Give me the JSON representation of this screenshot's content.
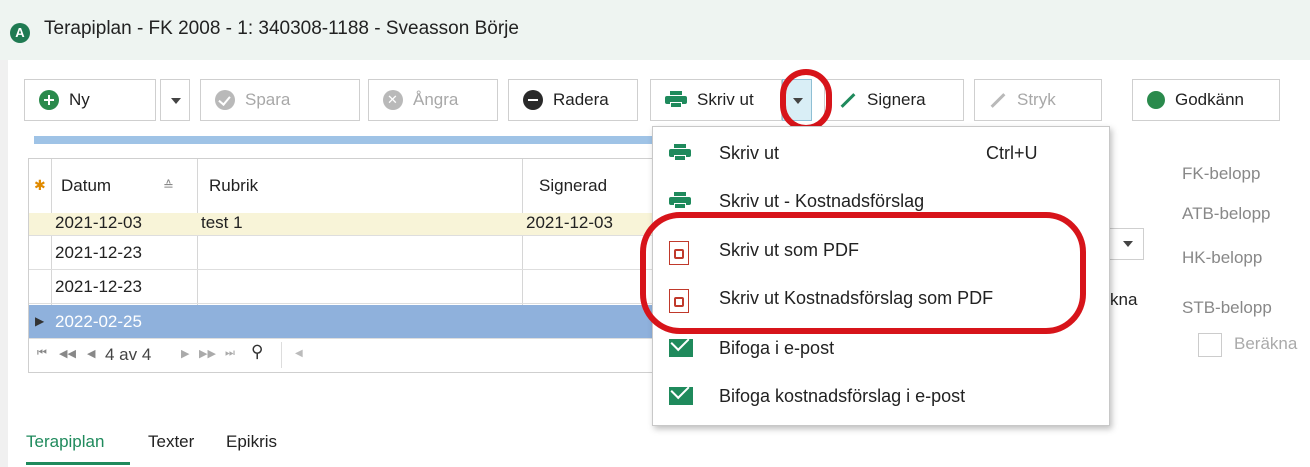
{
  "window": {
    "app_icon_letter": "A",
    "title": "Terapiplan - FK 2008 - 1: 340308-1188 - Sveasson Börje"
  },
  "toolbar": {
    "new_label": "Ny",
    "save_label": "Spara",
    "undo_label": "Ångra",
    "delete_label": "Radera",
    "print_label": "Skriv ut",
    "sign_label": "Signera",
    "strike_label": "Stryk",
    "approve_label": "Godkänn"
  },
  "grid": {
    "columns": [
      "Datum",
      "Rubrik",
      "Signerad"
    ],
    "rows": [
      {
        "datum": "2021-12-03",
        "rubrik": "test 1",
        "signerad": "2021-12-03"
      },
      {
        "datum": "2021-12-23",
        "rubrik": "",
        "signerad": ""
      },
      {
        "datum": "2021-12-23",
        "rubrik": "",
        "signerad": ""
      },
      {
        "datum": "2022-02-25",
        "rubrik": "",
        "signerad": ""
      }
    ],
    "record_position": "4 av 4"
  },
  "print_menu": {
    "items": [
      {
        "label": "Skriv ut",
        "shortcut": "Ctrl+U",
        "icon": "printer-icon"
      },
      {
        "label": "Skriv ut - Kostnadsförslag",
        "icon": "printer-icon"
      },
      {
        "label": "Skriv ut som PDF",
        "icon": "pdf-icon"
      },
      {
        "label": "Skriv ut Kostnadsförslag som PDF",
        "icon": "pdf-icon"
      },
      {
        "label": "Bifoga i e-post",
        "icon": "mail-icon"
      },
      {
        "label": "Bifoga kostnadsförslag i e-post",
        "icon": "mail-icon"
      }
    ]
  },
  "right_panel": {
    "fk_belopp": "FK-belopp",
    "atb_belopp": "ATB-belopp",
    "hk_belopp": "HK-belopp",
    "stb_belopp": "STB-belopp",
    "berakna": "Beräkna",
    "partial_text": "kna"
  },
  "tabs": [
    "Terapiplan",
    "Texter",
    "Epikris"
  ],
  "colors": {
    "accent_green": "#1f8a5c",
    "highlight_red": "#d7141a",
    "selected_row": "#8fb1dc"
  }
}
